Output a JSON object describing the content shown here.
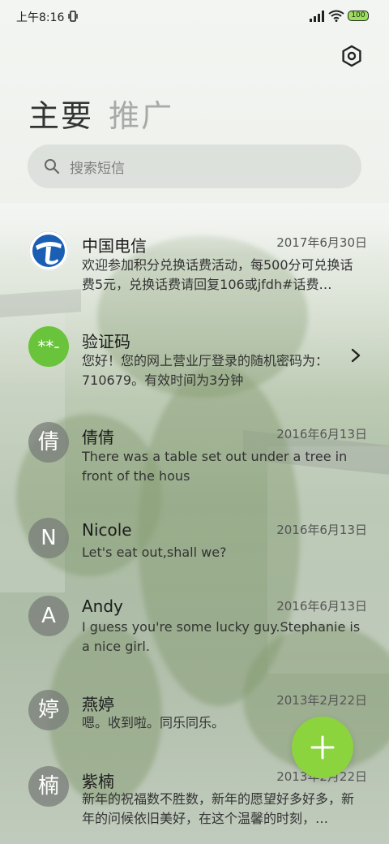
{
  "status_bar": {
    "time": "上午8:16",
    "battery": "100",
    "icons": [
      "vibrate-icon",
      "signal-icon",
      "wifi-icon",
      "battery-icon"
    ]
  },
  "header": {
    "settings_icon": "settings-hexagon-icon",
    "tabs": [
      {
        "label": "主要",
        "active": true
      },
      {
        "label": "推广",
        "active": false
      }
    ]
  },
  "search": {
    "icon": "search-icon",
    "placeholder": "搜索短信"
  },
  "conversations": [
    {
      "name": "中国电信",
      "date": "2017年6月30日",
      "avatar": "china-telecom-logo",
      "snippet": "欢迎参加积分兑换话费活动，每500分可兑换话费5元，兑换话费请回复106或jfdh#话费…"
    },
    {
      "name": "验证码",
      "date": "",
      "avatar": "**-",
      "snippet": "您好！您的网上营业厅登录的随机密码为：710679。有效时间为3分钟"
    },
    {
      "name": "倩倩",
      "date": "2016年6月13日",
      "avatar": "倩",
      "snippet": "There was a table set out under a tree in front of the hous"
    },
    {
      "name": "Nicole",
      "date": "2016年6月13日",
      "avatar": "N",
      "snippet": "Let's eat out,shall we?"
    },
    {
      "name": "Andy",
      "date": "2016年6月13日",
      "avatar": "A",
      "snippet": "I guess you're some lucky guy.Stephanie is a nice girl."
    },
    {
      "name": "燕婷",
      "date": "2013年2月22日",
      "avatar": "婷",
      "snippet": "嗯。收到啦。同乐同乐。"
    },
    {
      "name": "紫楠",
      "date": "2013年2月22日",
      "avatar": "楠",
      "snippet": "新年的祝福数不胜数，新年的愿望好多好多，新年的问候依旧美好，在这个温馨的时刻，…"
    }
  ],
  "fab": {
    "icon": "plus-icon"
  },
  "colors": {
    "accent_green": "#8cd43e",
    "avatar_gray": "#787c78",
    "telecom_blue": "#1a5fb4"
  }
}
